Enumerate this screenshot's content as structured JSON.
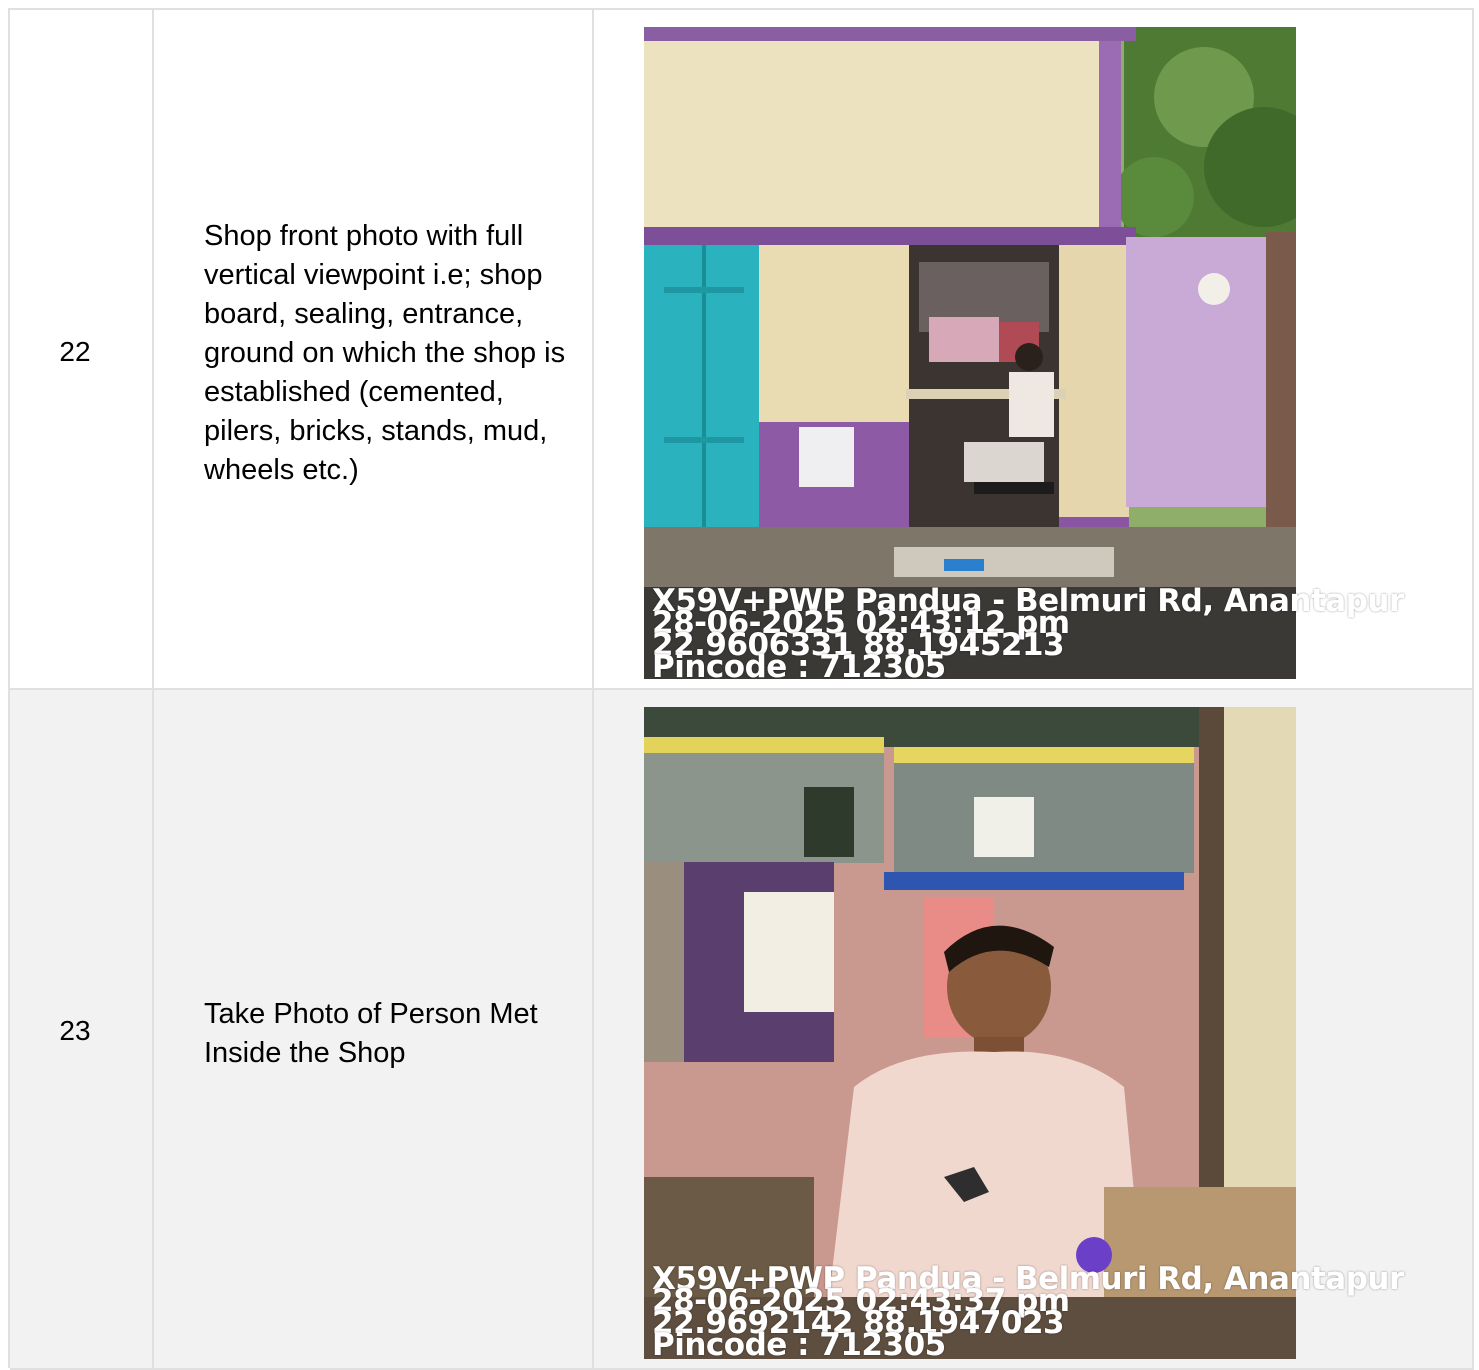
{
  "rows": [
    {
      "number": "22",
      "description": "Shop front photo with full vertical viewpoint i.e; shop board, sealing, entrance, ground on which the shop is established (cemented, pilers, bricks, stands, mud, wheels etc.)",
      "photo_stamp": {
        "address": "X59V+PWP Pandua - Belmuri Rd, Anantapur",
        "datetime": "28-06-2025 02:43:12 pm",
        "coords": "22.9606331 88.1945213",
        "pincode": "Pincode : 712305"
      }
    },
    {
      "number": "23",
      "description": "Take Photo of Person Met Inside the Shop",
      "photo_stamp": {
        "address": "X59V+PWP Pandua - Belmuri Rd, Anantapur",
        "datetime": "28-06-2025 02:43:37 pm",
        "coords": "22.9692142 88.1947023",
        "pincode": "Pincode : 712305"
      }
    }
  ]
}
